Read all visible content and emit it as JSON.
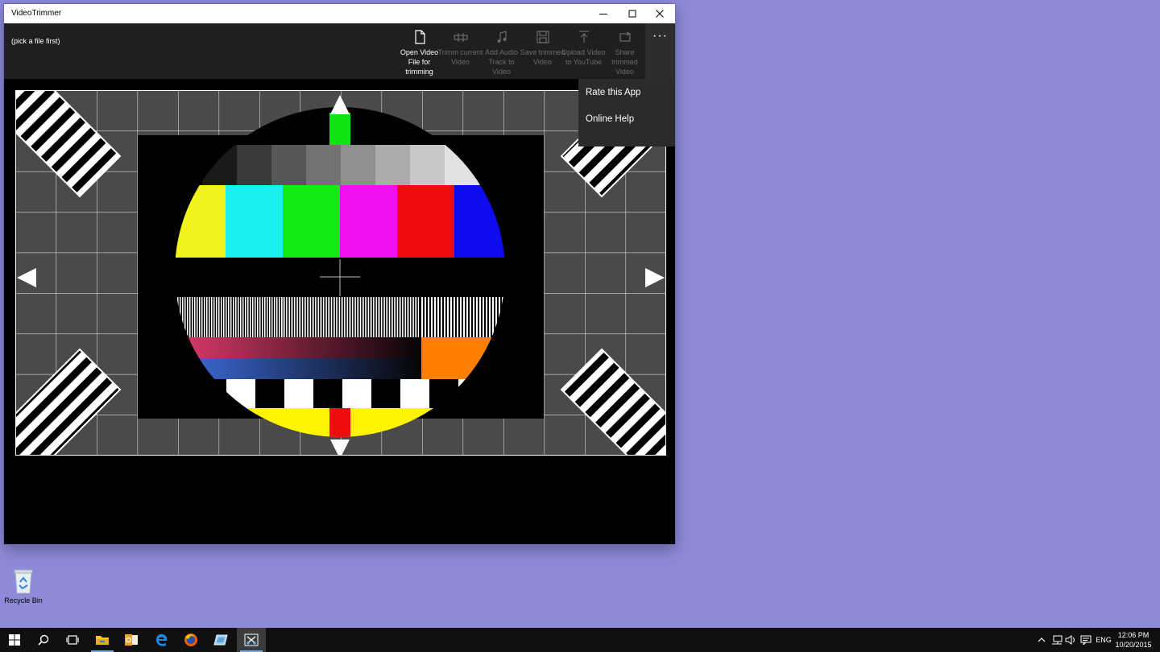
{
  "window": {
    "title": "VideoTrimmer",
    "controls": {
      "minimize": "minimize",
      "maximize": "maximize",
      "close": "close"
    }
  },
  "command_bar": {
    "status": "(pick a file first)",
    "buttons": [
      {
        "label": "Open Video File for trimming",
        "icon": "open-file-icon",
        "enabled": true
      },
      {
        "label": "Trimm current Video",
        "icon": "trim-icon",
        "enabled": false
      },
      {
        "label": "Add Audio Track to Video",
        "icon": "music-note-icon",
        "enabled": false
      },
      {
        "label": "Save trimmed Video",
        "icon": "save-icon",
        "enabled": false
      },
      {
        "label": "Upload Video to YouTube",
        "icon": "upload-icon",
        "enabled": false
      },
      {
        "label": "Share trimmed Video",
        "icon": "share-icon",
        "enabled": false
      }
    ],
    "more": "more-icon"
  },
  "overflow_menu": {
    "items": [
      {
        "label": "Rate this App"
      },
      {
        "label": "Online Help"
      }
    ]
  },
  "video": {
    "content": "test pattern",
    "color_bars": [
      "#f2f21c",
      "#17f0f0",
      "#12ec12",
      "#f010f0",
      "#ee0c0c",
      "#0c0cee"
    ],
    "gray_steps": [
      "#1a1a1a",
      "#3a3a3a",
      "#575757",
      "#737373",
      "#8f8f8f",
      "#ababab",
      "#c7c7c7",
      "#e2e2e2"
    ],
    "accent_colors": {
      "top_marker": "#0ee40e",
      "bottom_marker": "#ee0c0c",
      "bottom_band": "#fff500",
      "orange_block": "#ff8000"
    }
  },
  "desktop": {
    "recycle_bin": {
      "label": "Recycle Bin",
      "icon": "recycle-bin-icon"
    }
  },
  "taskbar": {
    "apps": [
      {
        "icon": "windows-start-icon"
      },
      {
        "icon": "search-icon"
      },
      {
        "icon": "task-view-icon"
      },
      {
        "icon": "file-explorer-icon"
      },
      {
        "icon": "outlook-icon"
      },
      {
        "icon": "edge-icon"
      },
      {
        "icon": "firefox-icon"
      },
      {
        "icon": "app-icon"
      },
      {
        "icon": "video-trimmer-icon"
      }
    ],
    "tray": {
      "language": "ENG",
      "time": "12:06 PM",
      "date": "10/20/2015"
    }
  }
}
